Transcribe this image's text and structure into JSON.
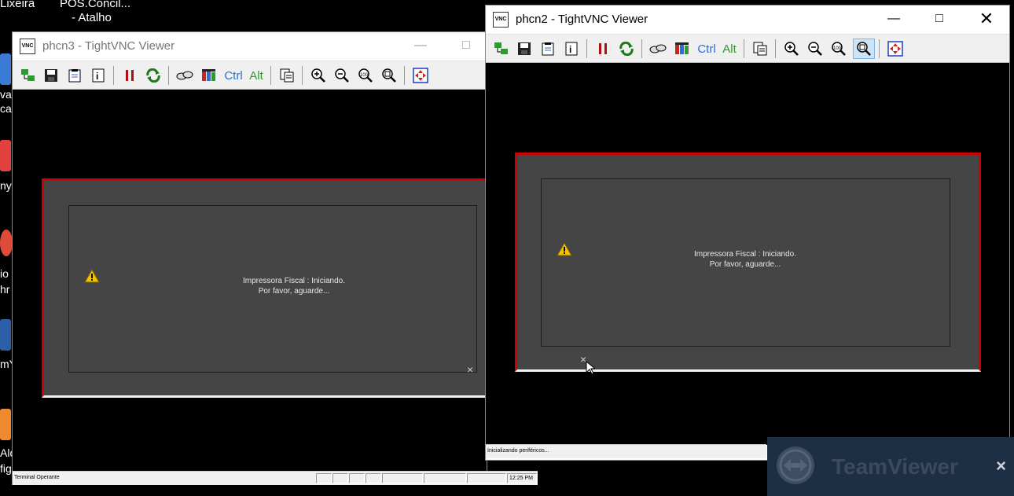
{
  "desktop": {
    "top_labels": [
      "Lixeira",
      "POS.Concil...",
      "- Atalho"
    ],
    "left_fragments": [
      "var",
      "ca",
      "ny",
      "io",
      "hr",
      "mY",
      "Ald",
      "fig"
    ]
  },
  "window_left": {
    "title": "phcn3 - TightVNC Viewer",
    "app_icon_text": "VNC",
    "toolbar": {
      "ctrl": "Ctrl",
      "alt": "Alt"
    },
    "dialog": {
      "line1": "Impressora Fiscal : Iniciando.",
      "line2": "Por favor, aguarde..."
    },
    "status": {
      "left": "Terminal Operante",
      "time": "12:25 PM"
    }
  },
  "window_right": {
    "title": "phcn2 - TightVNC Viewer",
    "app_icon_text": "VNC",
    "toolbar": {
      "ctrl": "Ctrl",
      "alt": "Alt"
    },
    "dialog": {
      "line1": "Impressora Fiscal : Iniciando.",
      "line2": "Por favor, aguarde..."
    },
    "status": {
      "left": "Inicializando periféricos..."
    }
  },
  "teamviewer": {
    "label": "TeamViewer",
    "close": "×"
  },
  "icons": {
    "toolbar": [
      "new-connection-icon",
      "save-icon",
      "options-icon",
      "info-icon",
      "pause-icon",
      "refresh-icon",
      "ctrl-alt-del-icon",
      "ctrl-esc-icon",
      "ctrl-key",
      "alt-key",
      "clipboard-icon",
      "zoom-in-icon",
      "zoom-out-icon",
      "zoom-100-icon",
      "zoom-fit-icon",
      "fullscreen-icon"
    ]
  }
}
